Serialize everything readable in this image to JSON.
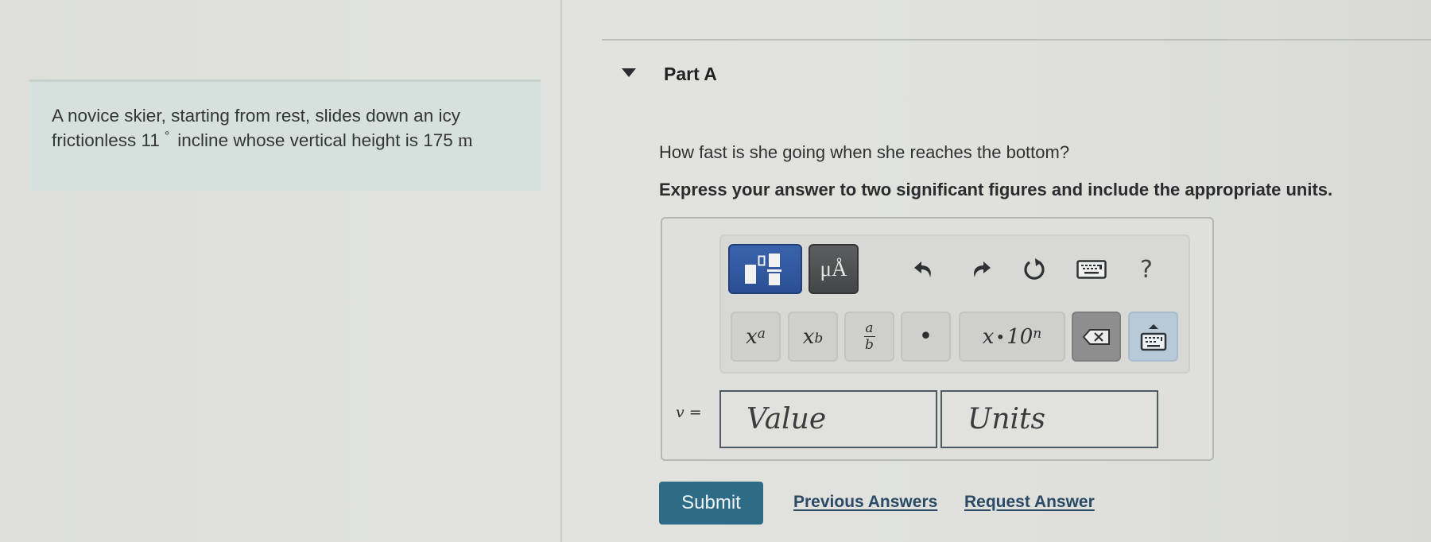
{
  "problem": {
    "text_before": "A novice skier, starting from rest, slides down an icy frictionless 11",
    "degree_symbol": "°",
    "text_after": "incline whose vertical height is 175",
    "unit": "m",
    "angle_deg": 11,
    "height_m": 175
  },
  "part": {
    "title": "Part A",
    "expanded": true,
    "question": "How fast is she going when she reaches the bottom?",
    "instruction": "Express your answer to two significant figures and include the appropriate units."
  },
  "toolbar": {
    "templates_label": "templates-icon",
    "units_label": "μÅ",
    "undo": "undo-icon",
    "redo": "redo-icon",
    "reset": "reset-icon",
    "keyboard": "keyboard-icon",
    "help_label": "?"
  },
  "keys": {
    "superscript_base": "x",
    "superscript_exp": "a",
    "subscript_base": "x",
    "subscript_sub": "b",
    "fraction_num": "a",
    "fraction_den": "b",
    "dot": "•",
    "sci_base": "x",
    "sci_dot": "•",
    "sci_ten": "10",
    "sci_exp": "n",
    "backspace": "backspace-icon",
    "keyboard_toggle": "keyboard-toggle-icon"
  },
  "answer": {
    "variable": "v",
    "equals": "=",
    "value_placeholder": "Value",
    "units_placeholder": "Units",
    "value": "",
    "units": ""
  },
  "actions": {
    "submit_label": "Submit",
    "previous_answers_label": "Previous Answers",
    "request_answer_label": "Request Answer"
  },
  "colors": {
    "submit_bg": "#2e6b86",
    "templates_btn": "#2b4f94",
    "units_btn": "#434546",
    "link": "#2a4a66",
    "problem_bg": "#d6e0dd"
  }
}
